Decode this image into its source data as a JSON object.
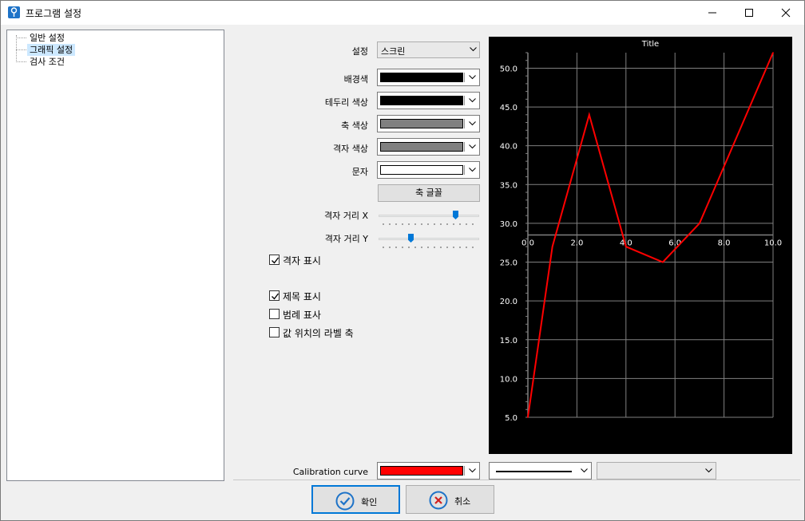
{
  "window": {
    "title": "프로그램 설정",
    "controls": {
      "minimize": "minimize-icon",
      "maximize": "maximize-icon",
      "close": "close-icon"
    }
  },
  "tree": {
    "items": [
      {
        "label": "일반 설정",
        "selected": false
      },
      {
        "label": "그래픽 설정",
        "selected": true
      },
      {
        "label": "검사 조건",
        "selected": false
      }
    ]
  },
  "settings": {
    "setting_label": "설정",
    "setting_value": "스크린",
    "background_label": "배경색",
    "background_color": "#000000",
    "border_label": "테두리 색상",
    "border_color": "#000000",
    "axis_label": "축 색상",
    "axis_color": "#808080",
    "grid_label": "격자 색상",
    "grid_color": "#808080",
    "text_label": "문자",
    "text_color": "#ffffff",
    "axis_font_button": "축 글꼴",
    "grid_x_label": "격자 거리 X",
    "grid_x_value": 0.78,
    "grid_y_label": "격자 거리 Y",
    "grid_y_value": 0.31,
    "show_grid_label": "격자 표시",
    "show_grid": true,
    "show_title_label": "제목 표시",
    "show_title": true,
    "show_legend_label": "범례 표사",
    "show_legend": false,
    "label_axis_label": "값 위치의 라벨 축",
    "label_axis": false,
    "calibration_label": "Calibration curve",
    "calibration_color": "#ff0000"
  },
  "buttons": {
    "ok": "확인",
    "cancel": "취소"
  },
  "chart_data": {
    "type": "line",
    "title": "Title",
    "x": [
      0.0,
      1.0,
      2.5,
      4.0,
      5.5,
      7.0,
      10.0
    ],
    "series": [
      {
        "values": [
          5.0,
          27.0,
          44.0,
          27.0,
          25.0,
          30.0,
          52.0
        ],
        "color": "#ff0000"
      }
    ],
    "xlim": [
      0.0,
      10.0
    ],
    "ylim": [
      5.0,
      52.0
    ],
    "xticks": [
      "0.0",
      "2.0",
      "4.0",
      "6.0",
      "8.0",
      "10.0"
    ],
    "yticks": [
      "5.0",
      "10.0",
      "15.0",
      "20.0",
      "25.0",
      "30.0",
      "35.0",
      "40.0",
      "45.0",
      "50.0"
    ],
    "x_axis_crosses_at": 28.5,
    "grid": true,
    "background": "#000000",
    "grid_color": "#808080",
    "text_color": "#ffffff"
  }
}
